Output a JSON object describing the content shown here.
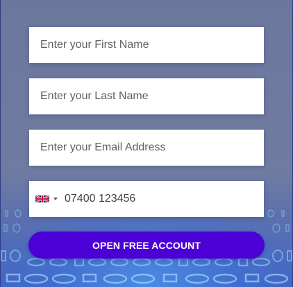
{
  "form": {
    "first_name": {
      "placeholder": "Enter your First Name",
      "value": ""
    },
    "last_name": {
      "placeholder": "Enter your Last Name",
      "value": ""
    },
    "email": {
      "placeholder": "Enter your Email Address",
      "value": ""
    },
    "phone": {
      "placeholder": "07400 123456",
      "value": "",
      "country_flag": "uk-flag-icon"
    },
    "submit_label": "OPEN FREE ACCOUNT"
  },
  "colors": {
    "background": "#6e7a9e",
    "field_bg": "#ffffff",
    "button": "#4b00d6",
    "button_text": "#ffffff",
    "binary_glow": "#6fc4ff"
  }
}
